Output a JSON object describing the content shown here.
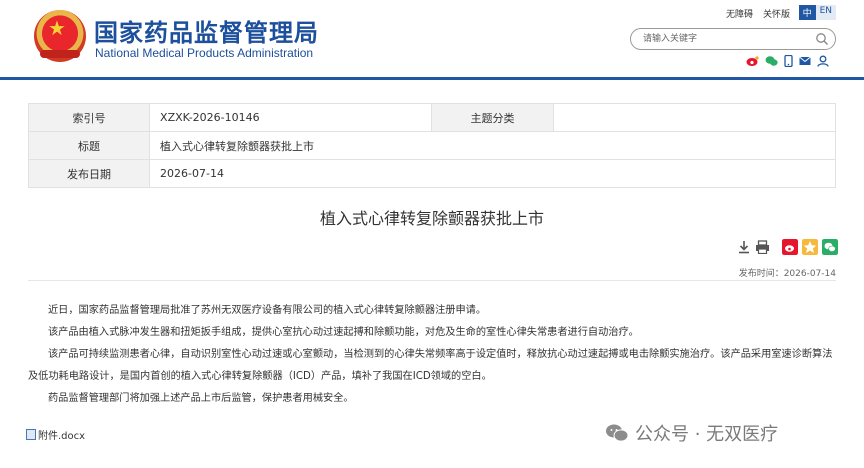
{
  "header": {
    "title_cn": "国家药品监督管理局",
    "title_en": "National Medical Products Administration",
    "links": [
      "无障碍",
      "关怀版"
    ],
    "lang_on": "中",
    "lang_off": "EN",
    "search_placeholder": "请输入关键字",
    "social_icons": [
      "weibo-icon",
      "wechat-icon",
      "mobile-icon",
      "mail-icon",
      "user-icon"
    ]
  },
  "info": {
    "index_label": "索引号",
    "index_value": "XZXK-2026-10146",
    "category_label": "主题分类",
    "category_value": "",
    "title_label": "标题",
    "title_value": "植入式心律转复除颤器获批上市",
    "date_label": "发布日期",
    "date_value": "2026-07-14"
  },
  "article": {
    "title": "植入式心律转复除颤器获批上市",
    "publish_time": "发布时间：2026-07-14",
    "paragraphs": [
      "近日，国家药品监督管理局批准了苏州无双医疗设备有限公司的植入式心律转复除颤器注册申请。",
      "该产品由植入式脉冲发生器和扭矩扳手组成，提供心室抗心动过速起搏和除颤功能，对危及生命的室性心律失常患者进行自动治疗。",
      "该产品可持续监测患者心律，自动识别室性心动过速或心室颤动，当检测到的心律失常频率高于设定值时，释放抗心动过速起搏或电击除颤实施治疗。该产品采用室速诊断算法及低功耗电路设计，是国内首创的植入式心律转复除颤器（ICD）产品，填补了我国在ICD领域的空白。",
      "药品监督管理部门将加强上述产品上市后监管，保护患者用械安全。"
    ],
    "attachment": "附件.docx"
  },
  "watermark": "公众号 · 无双医疗",
  "colors": {
    "brand_blue": "#1f57a4",
    "weibo_red": "#e6162d",
    "wechat_green": "#2aae67"
  }
}
